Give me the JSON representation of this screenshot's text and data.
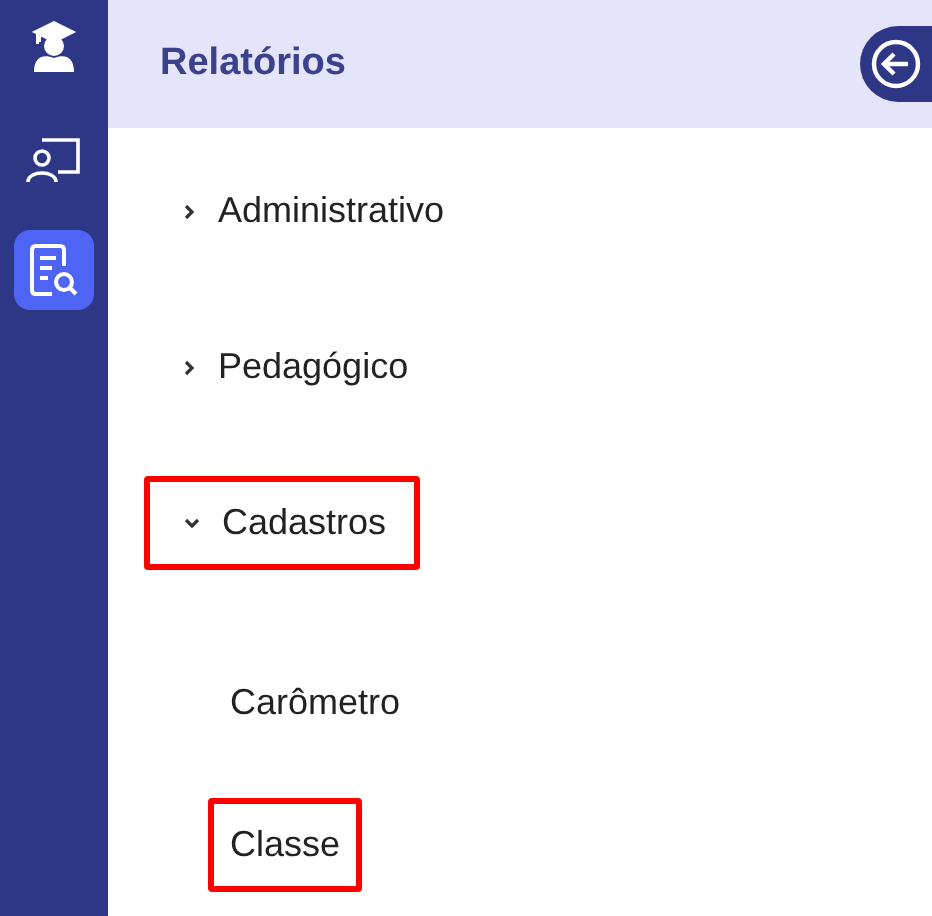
{
  "sidebar": {
    "items": [
      {
        "kind": "graduate",
        "selected": false
      },
      {
        "kind": "teacher",
        "selected": false
      },
      {
        "kind": "report",
        "selected": true
      }
    ]
  },
  "header": {
    "title": "Relatórios"
  },
  "menu": [
    {
      "label": "Administrativo",
      "expanded": false,
      "highlighted": false
    },
    {
      "label": "Pedagógico",
      "expanded": false,
      "highlighted": false
    },
    {
      "label": "Cadastros",
      "expanded": true,
      "highlighted": true,
      "children": [
        {
          "label": "Carômetro",
          "highlighted": false
        },
        {
          "label": "Classe",
          "highlighted": true
        }
      ]
    }
  ]
}
